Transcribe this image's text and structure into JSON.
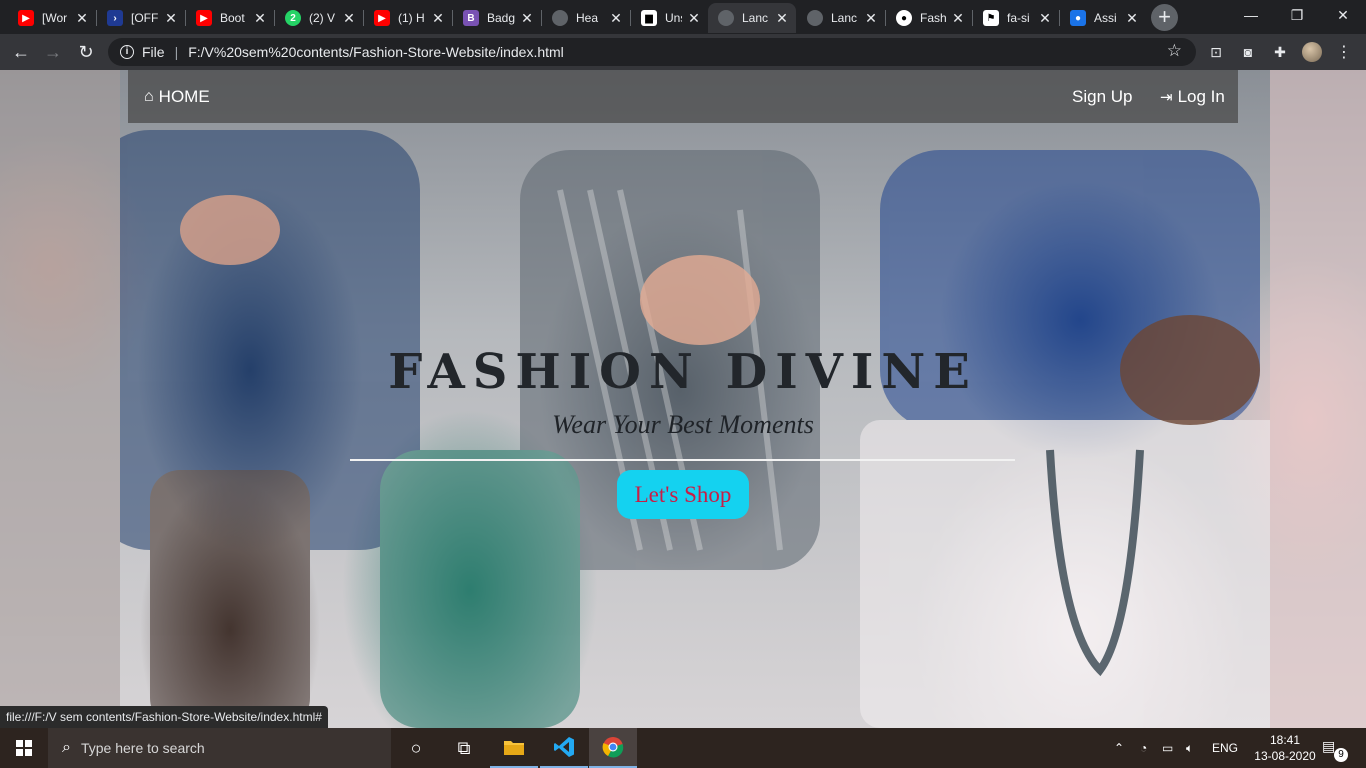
{
  "browser": {
    "tabs": [
      {
        "title": "[Wor",
        "icon": "youtube-icon",
        "color": "#ff0000"
      },
      {
        "title": "[OFF",
        "icon": "chevron-logo-icon",
        "color": "#1f3a93"
      },
      {
        "title": "Boot",
        "icon": "youtube-icon",
        "color": "#ff0000"
      },
      {
        "title": "(2) V",
        "icon": "whatsapp-icon",
        "color": "#25d366"
      },
      {
        "title": "(1) H",
        "icon": "youtube-icon",
        "color": "#ff0000"
      },
      {
        "title": "Badg",
        "icon": "bootstrap-icon",
        "color": "#7952b3"
      },
      {
        "title": "Hea",
        "icon": "globe-icon",
        "color": "#5f6368"
      },
      {
        "title": "Uns",
        "icon": "unsplash-icon",
        "color": "#ffffff"
      },
      {
        "title": "Lanc",
        "icon": "globe-icon",
        "color": "#5f6368",
        "active": true
      },
      {
        "title": "Lanc",
        "icon": "globe-icon",
        "color": "#5f6368"
      },
      {
        "title": "Fash",
        "icon": "github-icon",
        "color": "#ffffff"
      },
      {
        "title": "fa-si",
        "icon": "flag-icon",
        "color": "#ffffff"
      },
      {
        "title": "Assi",
        "icon": "contacts-icon",
        "color": "#1a73e8"
      }
    ],
    "address": {
      "scheme_label": "File",
      "url": "F:/V%20sem%20contents/Fashion-Store-Website/index.html"
    },
    "status_url": "file:///F:/V sem contents/Fashion-Store-Website/index.html#"
  },
  "page": {
    "nav": {
      "home_label": "HOME",
      "signup_label": "Sign Up",
      "login_label": "Log In"
    },
    "hero": {
      "title": "FASHION DIVINE",
      "subtitle": "Wear Your Best Moments",
      "cta_label": "Let's Shop"
    },
    "colors": {
      "cta_background": "#14d2f0",
      "cta_text": "#c81e46",
      "title_text": "#22262b"
    }
  },
  "taskbar": {
    "search_placeholder": "Type here to search",
    "language": "ENG",
    "time": "18:41",
    "date": "13-08-2020",
    "notification_count": "9"
  }
}
